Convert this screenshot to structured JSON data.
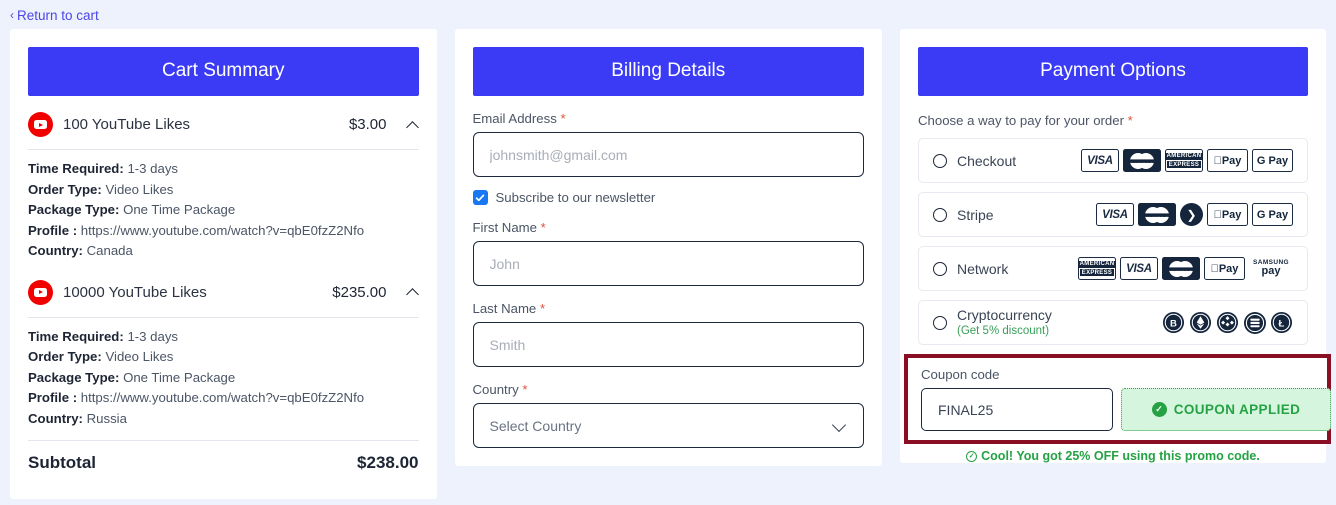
{
  "nav": {
    "return_label": "Return to cart",
    "chevron": "‹"
  },
  "cart": {
    "title": "Cart Summary",
    "items": [
      {
        "icon": "youtube-icon",
        "name": "100 YouTube Likes",
        "price": "$3.00",
        "details": [
          {
            "label": "Time Required:",
            "value": "1-3 days"
          },
          {
            "label": "Order Type:",
            "value": "Video Likes"
          },
          {
            "label": "Package Type:",
            "value": "One Time Package"
          },
          {
            "label": "Profile :",
            "value": "https://www.youtube.com/watch?v=qbE0fzZ2Nfo"
          },
          {
            "label": "Country:",
            "value": "Canada"
          }
        ]
      },
      {
        "icon": "youtube-icon",
        "name": "10000 YouTube Likes",
        "price": "$235.00",
        "details": [
          {
            "label": "Time Required:",
            "value": "1-3 days"
          },
          {
            "label": "Order Type:",
            "value": "Video Likes"
          },
          {
            "label": "Package Type:",
            "value": "One Time Package"
          },
          {
            "label": "Profile :",
            "value": "https://www.youtube.com/watch?v=qbE0fzZ2Nfo"
          },
          {
            "label": "Country:",
            "value": "Russia"
          }
        ]
      }
    ],
    "subtotal_label": "Subtotal",
    "subtotal_value": "$238.00"
  },
  "billing": {
    "title": "Billing Details",
    "email": {
      "label": "Email Address",
      "required": "*",
      "value": "",
      "placeholder": "johnsmith@gmail.com"
    },
    "newsletter": {
      "label": "Subscribe to our newsletter",
      "checked": true
    },
    "first_name": {
      "label": "First Name",
      "required": "*",
      "value": "",
      "placeholder": "John"
    },
    "last_name": {
      "label": "Last Name",
      "required": "*",
      "value": "",
      "placeholder": "Smith"
    },
    "country": {
      "label": "Country",
      "required": "*",
      "selected": "Select Country"
    }
  },
  "payment": {
    "title": "Payment Options",
    "note": "Choose a way to pay for your order",
    "note_required": "*",
    "options": [
      {
        "label": "Checkout",
        "sub": "",
        "selected": false,
        "icons": [
          "visa",
          "mastercard",
          "amex",
          "apple-pay",
          "google-pay"
        ]
      },
      {
        "label": "Stripe",
        "sub": "",
        "selected": false,
        "icons": [
          "visa",
          "mastercard",
          "stripe",
          "apple-pay",
          "google-pay"
        ]
      },
      {
        "label": "Network",
        "sub": "",
        "selected": false,
        "icons": [
          "amex",
          "visa",
          "mastercard",
          "apple-pay",
          "samsung-pay"
        ]
      },
      {
        "label": "Cryptocurrency",
        "sub": "(Get 5% discount)",
        "selected": false,
        "icons": [
          "bitcoin",
          "ethereum",
          "binance",
          "tether",
          "litecoin"
        ]
      }
    ],
    "coupon": {
      "label": "Coupon code",
      "value": "FINAL25",
      "button_label": "COUPON APPLIED",
      "message": "Cool! You got 25% OFF using this promo code."
    }
  },
  "colors": {
    "accent_blue": "#3b3bf5",
    "background": "#eef2fd",
    "success_green": "#25a244",
    "highlight_border": "#8b0f24",
    "youtube_red": "#f20000",
    "card_navy": "#14253c"
  },
  "marks": {
    "visa": "VISA",
    "mastercard": "MasterCard",
    "amex_line1": "AMERICAN",
    "amex_line2": "EXPRESS",
    "apple_pay": " Pay",
    "google_pay": "G Pay",
    "samsung_line1": "SAMSUNG",
    "samsung_line2": "pay",
    "stripe_arrow": "❯"
  }
}
